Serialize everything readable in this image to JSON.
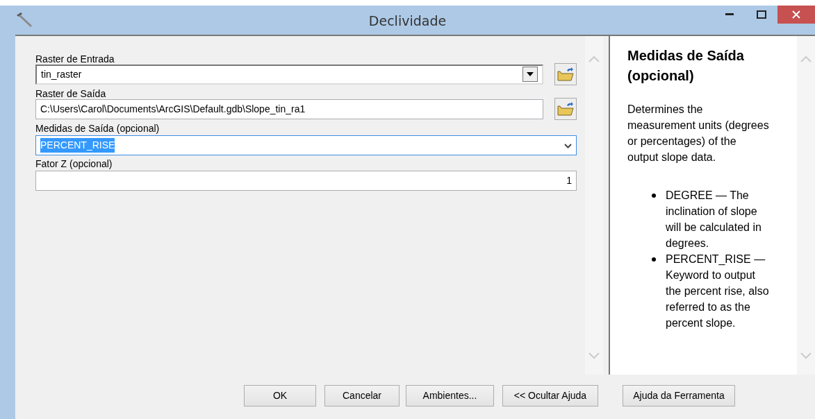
{
  "window": {
    "title": "Declividade"
  },
  "fields": [
    {
      "kind": "combo",
      "label": "Raster de Entrada",
      "value": "tin_raster",
      "browse": true,
      "highlighted": false
    },
    {
      "kind": "text",
      "label": "Raster de Saída",
      "value": "C:\\Users\\Carol\\Documents\\ArcGIS\\Default.gdb\\Slope_tin_ra1",
      "browse": true,
      "highlighted": false
    },
    {
      "kind": "dropdown",
      "label": "Medidas de Saída (opcional)",
      "value": "PERCENT_RISE",
      "browse": false,
      "highlighted": true
    },
    {
      "kind": "number",
      "label": "Fator Z (opcional)",
      "value": "1",
      "browse": false,
      "highlighted": false
    }
  ],
  "help": {
    "title": "Medidas de Saída (opcional)",
    "description": "Determines the measurement units (degrees or percentages) of the output slope data.",
    "items": [
      "DEGREE — The inclination of slope will be calculated in degrees.",
      "PERCENT_RISE — Keyword to output the percent rise, also referred to as the percent slope."
    ]
  },
  "buttons": [
    "OK",
    "Cancelar",
    "Ambientes...",
    "<< Ocultar Ajuda",
    "Ajuda da Ferramenta"
  ]
}
